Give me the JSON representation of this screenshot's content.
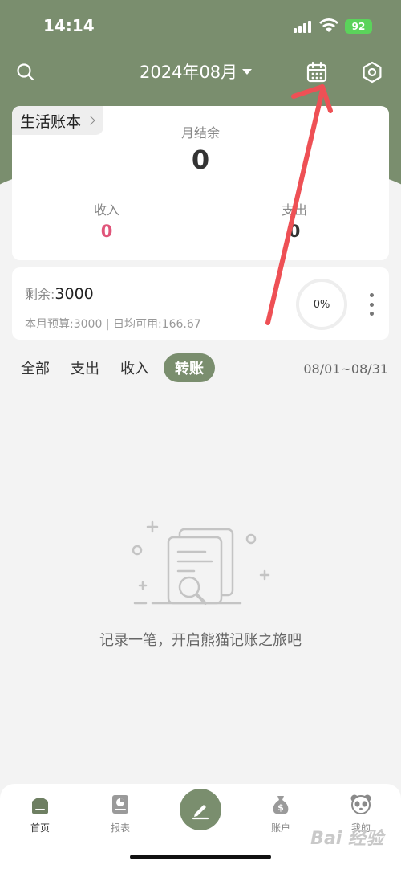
{
  "status_bar": {
    "time": "14:14",
    "battery": "92"
  },
  "header": {
    "month": "2024年08月"
  },
  "summary": {
    "book_name": "生活账本",
    "balance_label": "月结余",
    "balance_value": "0",
    "income_label": "收入",
    "income_value": "0",
    "expense_label": "支出",
    "expense_value": "0"
  },
  "budget": {
    "remain_label": "剩余:",
    "remain_value": "3000",
    "meta": "本月预算:3000 | 日均可用:166.67",
    "progress": "0%"
  },
  "filters": {
    "tabs": [
      "全部",
      "支出",
      "收入",
      "转账"
    ],
    "active_index": 3,
    "date_range": "08/01~08/31"
  },
  "empty_state": {
    "text": "记录一笔，开启熊猫记账之旅吧"
  },
  "bottom_nav": {
    "items": [
      "首页",
      "报表",
      "账户",
      "我的"
    ]
  },
  "watermark": "Bai 经验",
  "colors": {
    "accent": "#7a8e6e",
    "income": "#e0557a",
    "annotation": "#ee5055"
  }
}
